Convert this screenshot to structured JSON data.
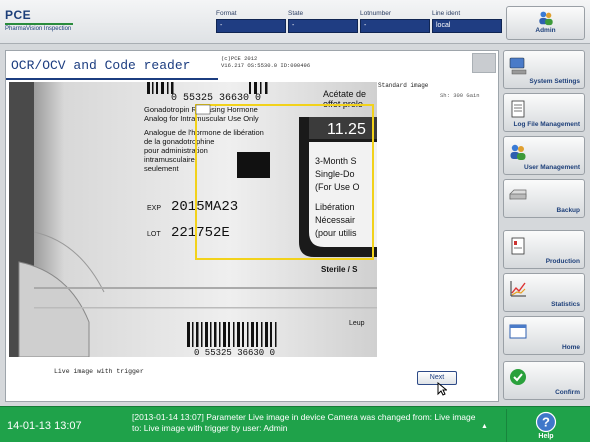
{
  "header": {
    "logo_title": "PCE",
    "logo_subtitle": "PharmaVision Inspection",
    "fields": [
      {
        "label": "Format",
        "value": "-"
      },
      {
        "label": "State",
        "value": "-"
      },
      {
        "label": "Lotnumber",
        "value": "-"
      },
      {
        "label": "Line ident",
        "value": "local"
      }
    ],
    "user_button": {
      "label": "Admin",
      "icon": "users-icon"
    }
  },
  "main": {
    "title": "OCR/OCV and Code reader",
    "camera_info": [
      "(c)PCE 2012",
      "V16.217 OS:5530.0 ID:000496"
    ],
    "image_type": "Standard image",
    "image_resolution": "Sh: 300 Gain",
    "live_label": "Live image with trigger",
    "next_button": "Next",
    "camera_text": {
      "barcode_top": "0 55325 36630 0",
      "barcode_bottom": "0 55325 36630 0",
      "line1": "Gonadotropin Releasing Hormone",
      "line2": "Analog for Intramuscular Use Only",
      "line3": "Analogue de l'hormone de libération",
      "line4": "de la gonadotrophine",
      "line5": "pour administration",
      "line6": "intramusculaire",
      "line7": "seulement",
      "exp_label": "EXP",
      "exp_value": "2015MA23",
      "lot_label": "LOT",
      "lot_value": "221752E",
      "right1": "Acétate de",
      "right2": "effet prolo",
      "right3": "11.25",
      "right4": "3-Month S",
      "right5": "Single-Do",
      "right6": "(For Use O",
      "right7": "Libération",
      "right8": "Nécessair",
      "right9": "(pour utilis",
      "right10": "Sterile / S",
      "right11": "Leup"
    }
  },
  "sidebar": [
    {
      "label": "System Settings",
      "icon": "computer-icon"
    },
    {
      "label": "Log File Management",
      "icon": "document-icon"
    },
    {
      "label": "User Management",
      "icon": "users-icon"
    },
    {
      "label": "Backup",
      "icon": "drive-icon"
    },
    {
      "label": "Production",
      "icon": "production-icon"
    },
    {
      "label": "Statistics",
      "icon": "chart-icon"
    },
    {
      "label": "Home",
      "icon": "home-window-icon"
    },
    {
      "label": "Confirm",
      "icon": "check-icon"
    }
  ],
  "status": {
    "datetime": "14-01-13 13:07",
    "message": "[2013-01-14 13:07] Parameter Live image in device Camera was changed from: Live image           to: Live image with trigger by user: Admin",
    "help_label": "Help",
    "colors": {
      "status_bg": "#1fa24a",
      "accent": "#1d3f7a"
    }
  }
}
